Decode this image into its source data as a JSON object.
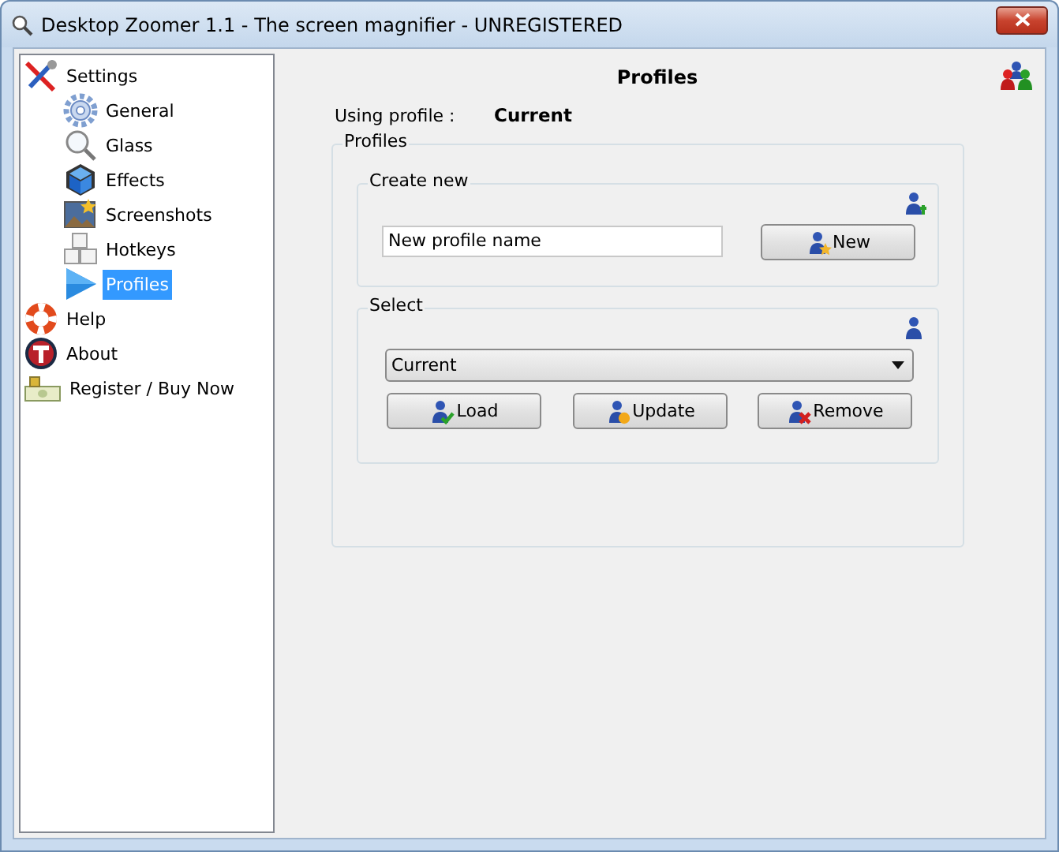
{
  "window": {
    "title": "Desktop Zoomer 1.1 - The screen magnifier - UNREGISTERED"
  },
  "sidebar": {
    "items": [
      {
        "label": "Settings",
        "kind": "tools",
        "selected": false,
        "children": [
          {
            "label": "General",
            "kind": "gear",
            "selected": false
          },
          {
            "label": "Glass",
            "kind": "magnifier",
            "selected": false
          },
          {
            "label": "Effects",
            "kind": "cube",
            "selected": false
          },
          {
            "label": "Screenshots",
            "kind": "image",
            "selected": false
          },
          {
            "label": "Hotkeys",
            "kind": "keys",
            "selected": false
          },
          {
            "label": "Profiles",
            "kind": "play",
            "selected": true
          }
        ]
      },
      {
        "label": "Help",
        "kind": "lifebuoy",
        "selected": false
      },
      {
        "label": "About",
        "kind": "badge",
        "selected": false
      },
      {
        "label": "Register / Buy Now",
        "kind": "money",
        "selected": false
      }
    ]
  },
  "page": {
    "title": "Profiles",
    "using_label": "Using profile :",
    "using_value": "Current"
  },
  "profiles_group": {
    "title": "Profiles",
    "create_new": {
      "title": "Create new",
      "name_field": {
        "value": "New profile name"
      },
      "button": "New"
    },
    "select": {
      "title": "Select",
      "dropdown": {
        "value": "Current"
      },
      "buttons": [
        {
          "label": "Load",
          "kind": "load"
        },
        {
          "label": "Update",
          "kind": "update"
        },
        {
          "label": "Remove",
          "kind": "remove"
        }
      ]
    }
  }
}
